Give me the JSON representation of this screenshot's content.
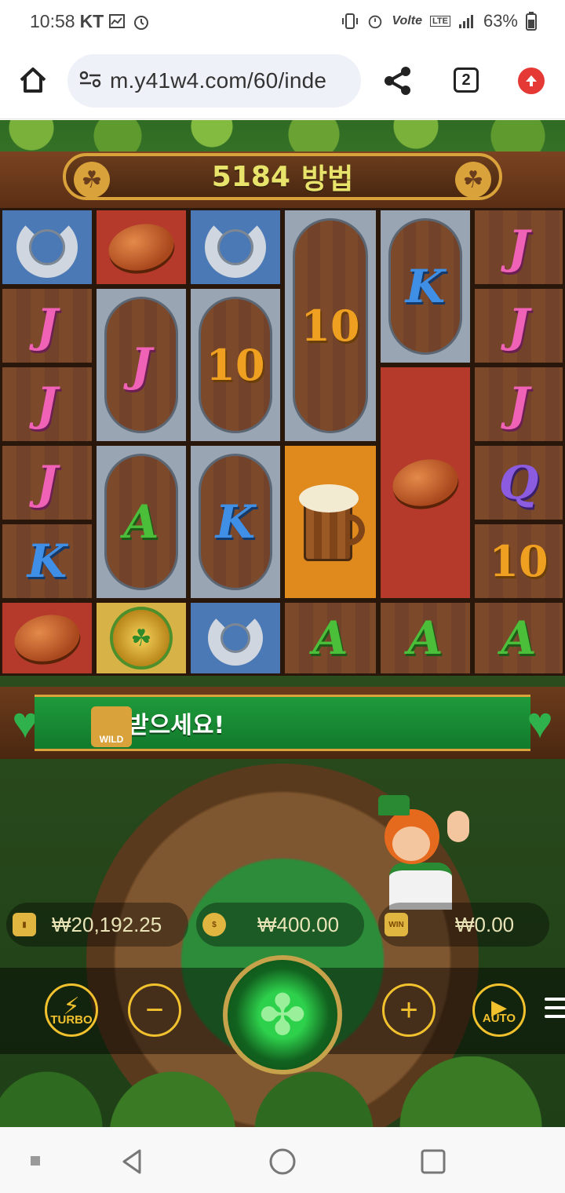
{
  "status_bar": {
    "time": "10:58",
    "carrier": "KT",
    "volte": "Volte",
    "lte": "LTE",
    "battery": "63%"
  },
  "browser": {
    "url": "m.y41w4.com/60/inde",
    "tab_count": "2"
  },
  "game": {
    "ways_count": "5184",
    "ways_label": "방법",
    "message": "을 받으세요!",
    "wild_label": "WILD",
    "balance": "₩20,192.25",
    "bet": "₩400.00",
    "win": "₩0.00",
    "win_icon_label": "WIN",
    "turbo_label": "TURBO",
    "auto_label": "AUTO",
    "minus_symbol": "−",
    "plus_symbol": "+",
    "reels": [
      [
        "horseshoe",
        "J",
        "J",
        "J",
        "K",
        "bread"
      ],
      [
        "bread",
        "J",
        "A",
        "pot"
      ],
      [
        "horseshoe",
        "10",
        "K",
        "horseshoe"
      ],
      [
        "10",
        "mug",
        "A"
      ],
      [
        "K",
        "bread",
        "A"
      ],
      [
        "J",
        "J",
        "J",
        "Q",
        "10",
        "A"
      ]
    ]
  },
  "accent_colors": {
    "gold": "#f2c12e",
    "green": "#1f9a3c",
    "wood": "#7c4a2a"
  }
}
